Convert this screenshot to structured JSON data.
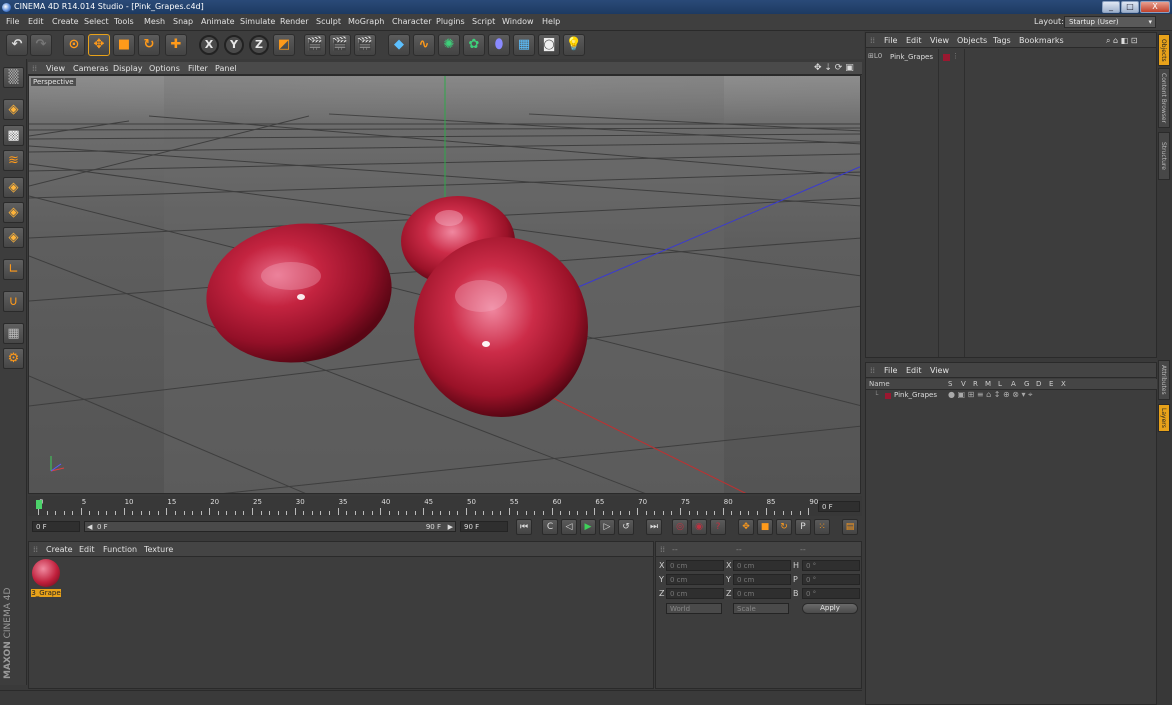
{
  "window": {
    "title": "CINEMA 4D R14.014 Studio - [Pink_Grapes.c4d]",
    "minimize_label": "_",
    "maximize_label": "□",
    "close_label": "X"
  },
  "menubar": {
    "items": [
      "File",
      "Edit",
      "Create",
      "Select",
      "Tools",
      "Mesh",
      "Snap",
      "Animate",
      "Simulate",
      "Render",
      "Sculpt",
      "MoGraph",
      "Character",
      "Plugins",
      "Script",
      "Window",
      "Help"
    ],
    "layout_label": "Layout:",
    "layout_value": "Startup (User)"
  },
  "viewport": {
    "menu": [
      "View",
      "Cameras",
      "Display",
      "Options",
      "Filter",
      "Panel"
    ],
    "camera_label": "Perspective"
  },
  "timeline": {
    "ticks": [
      "0",
      "5",
      "10",
      "15",
      "20",
      "25",
      "30",
      "35",
      "40",
      "45",
      "50",
      "55",
      "60",
      "65",
      "70",
      "75",
      "80",
      "85",
      "90"
    ],
    "current_frame": "0 F"
  },
  "timecontrols": {
    "start_field": "0 F",
    "slider_start": "0 F",
    "slider_end": "90 F",
    "end_field": "90 F"
  },
  "material_panel": {
    "menu": [
      "Create",
      "Edit",
      "Function",
      "Texture"
    ],
    "materials": [
      {
        "name": "3_Grape"
      }
    ]
  },
  "attributes": {
    "headers": [
      "--",
      "--",
      "--"
    ],
    "rows": [
      {
        "a": "X",
        "a_val": "0 cm",
        "b": "X",
        "b_val": "0 cm",
        "c": "H",
        "c_val": "0 °"
      },
      {
        "a": "Y",
        "a_val": "0 cm",
        "b": "Y",
        "b_val": "0 cm",
        "c": "P",
        "c_val": "0 °"
      },
      {
        "a": "Z",
        "a_val": "0 cm",
        "b": "Z",
        "b_val": "0 cm",
        "c": "B",
        "c_val": "0 °"
      }
    ],
    "coord_system": "World",
    "mode": "Scale",
    "apply_label": "Apply"
  },
  "object_manager": {
    "menu": [
      "File",
      "Edit",
      "View",
      "Objects",
      "Tags",
      "Bookmarks"
    ],
    "objects": [
      {
        "name": "Pink_Grapes"
      }
    ]
  },
  "layer_manager": {
    "menu": [
      "File",
      "Edit",
      "View"
    ],
    "columns": [
      "Name",
      "S",
      "V",
      "R",
      "M",
      "L",
      "A",
      "G",
      "D",
      "E",
      "X"
    ],
    "layers": [
      {
        "name": "Pink_Grapes"
      }
    ]
  },
  "side_tabs": [
    "Objects",
    "Content Browser",
    "Structure",
    "Attributes",
    "Layers"
  ],
  "branding": {
    "maxon": "MAXON",
    "product": "CINEMA 4D"
  },
  "colors": {
    "accent": "#ff9a1a",
    "layer_color": "#9a1830",
    "selection": "#e8a21a"
  }
}
